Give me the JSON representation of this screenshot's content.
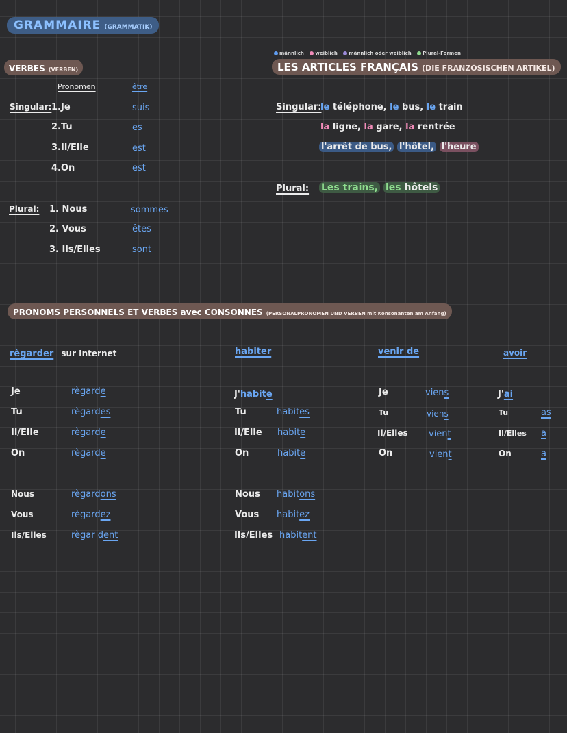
{
  "header": {
    "title": "GRAMMAIRE",
    "subtitle": "(GRAMMATIK)"
  },
  "verbes": {
    "title": "VERBES",
    "subtitle": "(VERBEN)",
    "col_pronomen": "Pronomen",
    "col_etre": "être",
    "singular_label": "Singular:",
    "plural_label": "Plural:",
    "rows": [
      {
        "p": "1.Je",
        "v": "suis"
      },
      {
        "p": "2.Tu",
        "v": "es"
      },
      {
        "p": "3.Il/Elle",
        "v": "est"
      },
      {
        "p": "4.On",
        "v": "est"
      },
      {
        "p": "1. Nous",
        "v": "sommes"
      },
      {
        "p": "2. Vous",
        "v": "êtes"
      },
      {
        "p": "3. Ils/Elles",
        "v": "sont"
      }
    ]
  },
  "legend": {
    "items": [
      {
        "label": "männlich",
        "color": "#5f9cf0"
      },
      {
        "label": "weiblich",
        "color": "#f08bb8"
      },
      {
        "label": "männlich oder weiblich",
        "color": "#9b8ad8"
      },
      {
        "label": "Plural-Formen",
        "color": "#8fdc8f"
      }
    ]
  },
  "articles": {
    "title": "LES ARTICLES FRANÇAIS",
    "subtitle": "(DIE FRANZÖSISCHEN ARTIKEL)",
    "singular_label": "Singular:",
    "plural_label": "Plural:",
    "line1": [
      {
        "a": "le",
        "n": "téléphone,"
      },
      {
        "a": "le",
        "n": "bus,"
      },
      {
        "a": "le",
        "n": "train"
      }
    ],
    "line2": [
      {
        "a": "la",
        "n": "ligne,"
      },
      {
        "a": "la",
        "n": "gare,"
      },
      {
        "a": "la",
        "n": "rentrée"
      }
    ],
    "line3": [
      "l'arrêt de bus,",
      "l'hôtel,",
      "l'heure"
    ],
    "plural": [
      "Les trains,",
      "les",
      "hôtels"
    ]
  },
  "pronoms": {
    "title": "PRONOMS PERSONNELS ET VERBES avec CONSONNES",
    "subtitle": "(PERSONALPRONOMEN UND VERBEN mit Konsonanten am Anfang)"
  },
  "regarder": {
    "title": "règarder",
    "suffix": "sur Internet",
    "rows": [
      {
        "p": "Je",
        "stem": "règard",
        "end": "e"
      },
      {
        "p": "Tu",
        "stem": "règard",
        "end": "es"
      },
      {
        "p": "Il/Elle",
        "stem": "règard",
        "end": "e"
      },
      {
        "p": "On",
        "stem": "règard",
        "end": "e"
      },
      {
        "p": "Nous",
        "stem": "règard",
        "end": "ons"
      },
      {
        "p": "Vous",
        "stem": "règard",
        "end": "ez"
      },
      {
        "p": "Ils/Elles",
        "stem": "règar d",
        "end": "ent"
      }
    ]
  },
  "habiter": {
    "title": "habiter",
    "rows": [
      {
        "p": "J'",
        "stem": "habit",
        "end": "e"
      },
      {
        "p": "Tu",
        "stem": "habit",
        "end": "es"
      },
      {
        "p": "Il/Elle",
        "stem": "habit",
        "end": "e"
      },
      {
        "p": "On",
        "stem": "habit",
        "end": "e"
      },
      {
        "p": "Nous",
        "stem": "habit",
        "end": "ons"
      },
      {
        "p": "Vous",
        "stem": "habit",
        "end": "ez"
      },
      {
        "p": "Ils/Elles",
        "stem": "habit",
        "end": "ent"
      }
    ]
  },
  "venir": {
    "title": "venir de",
    "rows": [
      {
        "p": "Je",
        "stem": "vien",
        "end": "s"
      },
      {
        "p": "Tu",
        "stem": "vien",
        "end": "s"
      },
      {
        "p": "Il/Elles",
        "stem": "vien",
        "end": "t"
      },
      {
        "p": "On",
        "stem": "vien",
        "end": "t"
      }
    ]
  },
  "avoir": {
    "title": "avoir",
    "rows": [
      {
        "p": "J'",
        "v": "ai"
      },
      {
        "p": "Tu",
        "v": "as"
      },
      {
        "p": "Il/Elles",
        "v": "a"
      },
      {
        "p": "On",
        "v": "a"
      }
    ]
  }
}
